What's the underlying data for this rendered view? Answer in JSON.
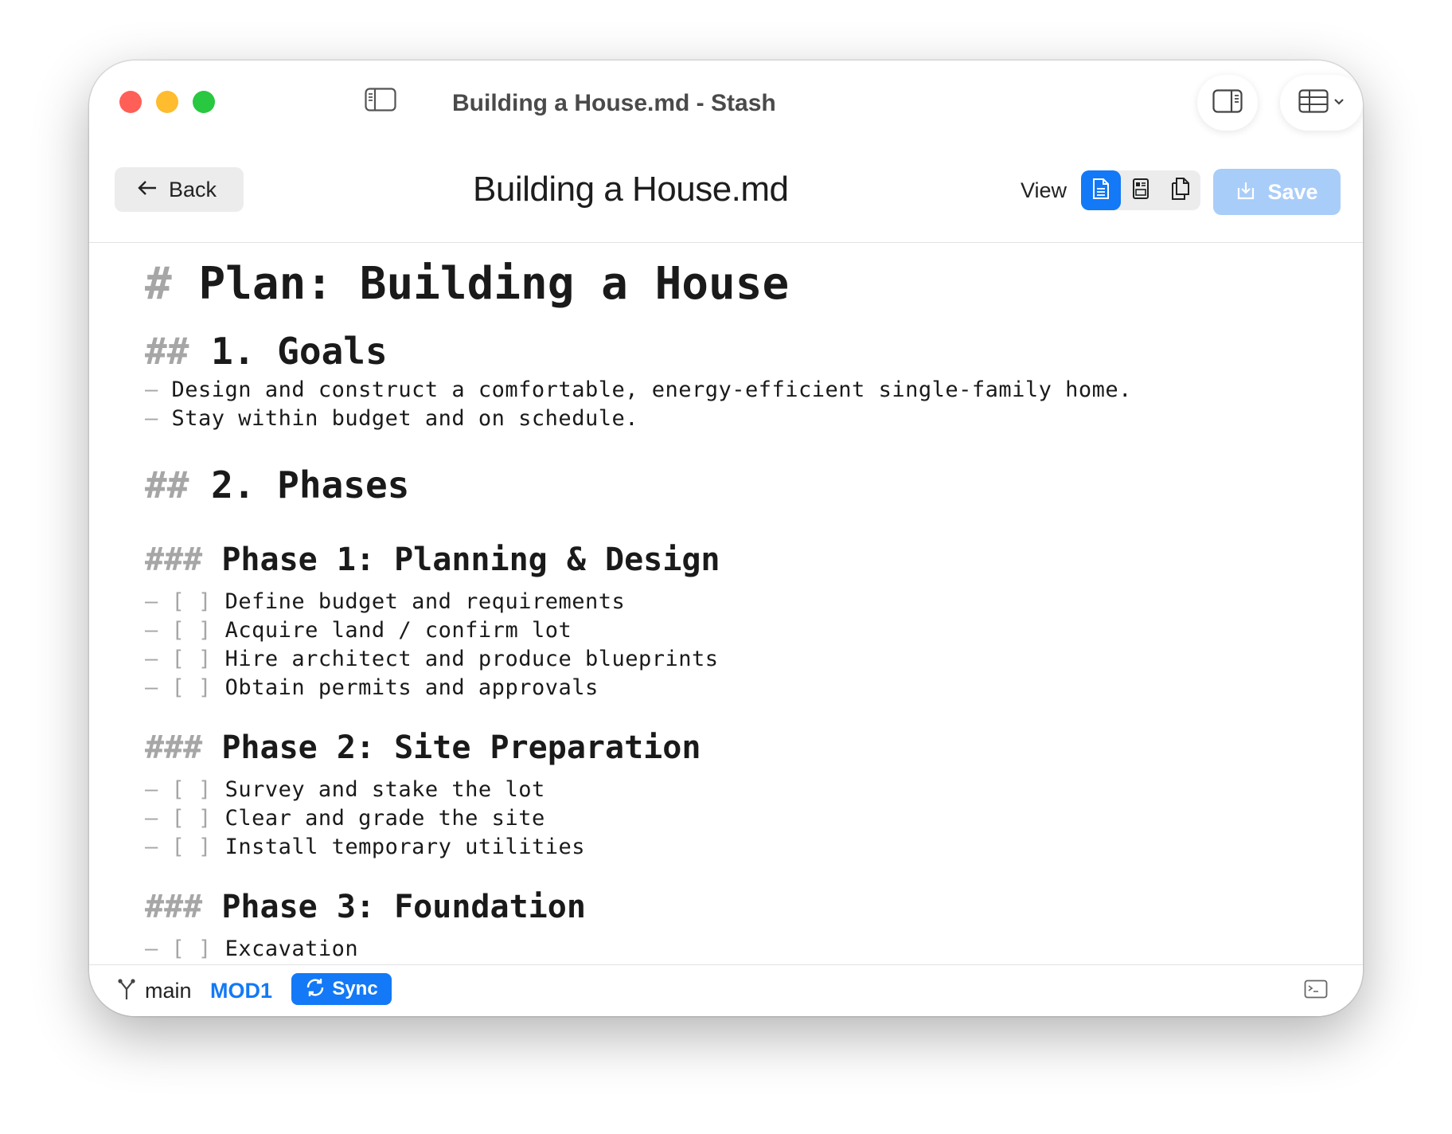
{
  "window": {
    "title": "Building a House.md - Stash"
  },
  "toolbar": {
    "back_label": "Back",
    "doc_title": "Building a House.md",
    "view_label": "View",
    "save_label": "Save",
    "view_modes": [
      "source-icon",
      "preview-icon",
      "split-icon"
    ],
    "active_view": "source"
  },
  "editor": {
    "h1": {
      "marker": "#",
      "text": "Plan: Building a House"
    },
    "goals": {
      "heading": {
        "marker": "##",
        "text": "1. Goals"
      },
      "items": [
        "Design and construct a comfortable, energy-efficient single-family home.",
        "Stay within budget and on schedule."
      ]
    },
    "phases": {
      "heading": {
        "marker": "##",
        "text": "2. Phases"
      }
    },
    "phase1": {
      "heading": {
        "marker": "###",
        "text": "Phase 1: Planning & Design"
      },
      "tasks": [
        "Define budget and requirements",
        "Acquire land / confirm lot",
        "Hire architect and produce blueprints",
        "Obtain permits and approvals"
      ]
    },
    "phase2": {
      "heading": {
        "marker": "###",
        "text": "Phase 2: Site Preparation"
      },
      "tasks": [
        "Survey and stake the lot",
        "Clear and grade the site",
        "Install temporary utilities"
      ]
    },
    "phase3": {
      "heading": {
        "marker": "###",
        "text": "Phase 3: Foundation"
      },
      "tasks": [
        "Excavation"
      ]
    },
    "bullet": "–",
    "checkbox": "[ ]"
  },
  "status": {
    "branch": "main",
    "modified": "MOD1",
    "sync_label": "Sync"
  },
  "colors": {
    "accent": "#1379f6",
    "save_disabled": "#a9cdf9",
    "markdown_marker": "#a6a6a6"
  }
}
